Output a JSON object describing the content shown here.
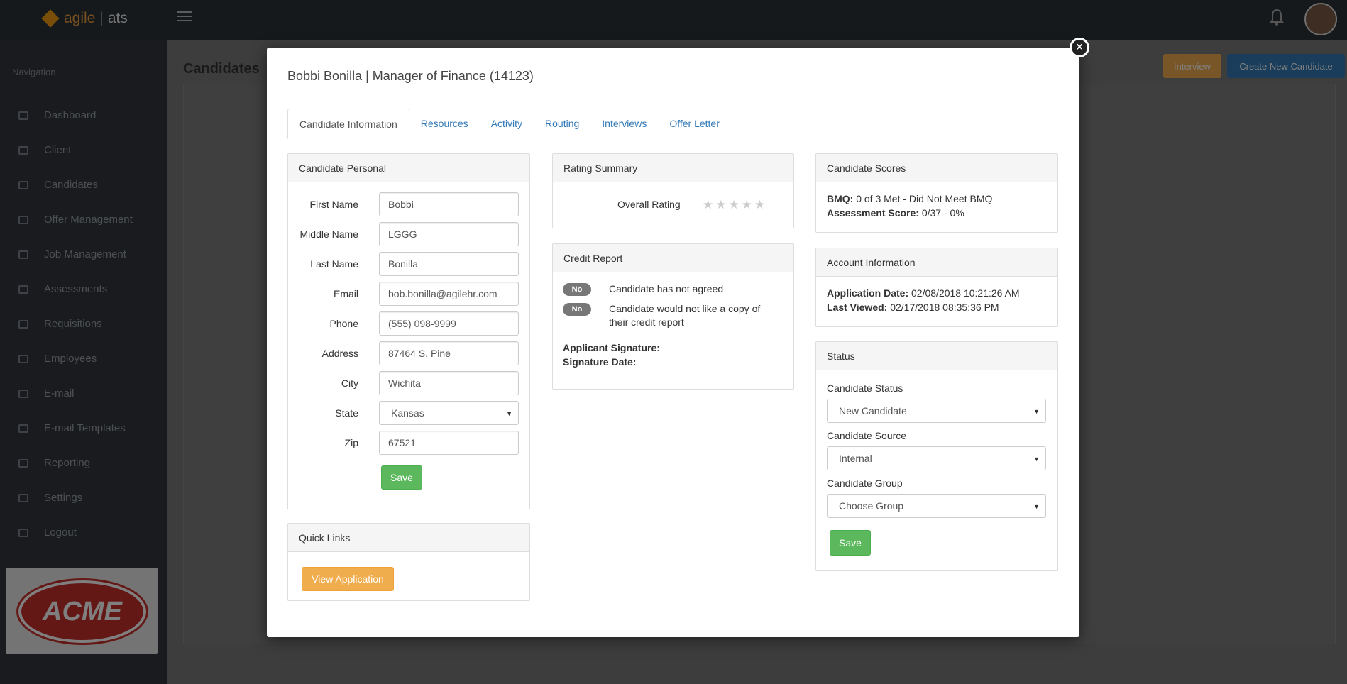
{
  "app": {
    "logo_text_1": "agile",
    "logo_sep": "|",
    "logo_text_2": "ats",
    "nav_title": "Navigation",
    "nav_items": [
      "Dashboard",
      "Client",
      "Candidates",
      "Offer Management",
      "Job Management",
      "Assessments",
      "Requisitions",
      "Employees",
      "E-mail",
      "E-mail Templates",
      "Reporting",
      "Settings",
      "Logout"
    ],
    "page_title": "Candidates",
    "interview_btn": "Interview",
    "create_btn": "Create New Candidate",
    "brand_logo": "ACME"
  },
  "modal": {
    "title": "Bobbi Bonilla | Manager of Finance (14123)",
    "close_glyph": "×",
    "tabs": [
      "Candidate Information",
      "Resources",
      "Activity",
      "Routing",
      "Interviews",
      "Offer Letter"
    ],
    "personal": {
      "heading": "Candidate Personal",
      "fields": [
        {
          "label": "First Name",
          "value": "Bobbi"
        },
        {
          "label": "Middle Name",
          "value": "LGGG"
        },
        {
          "label": "Last Name",
          "value": "Bonilla"
        },
        {
          "label": "Email",
          "value": "bob.bonilla@agilehr.com"
        },
        {
          "label": "Phone",
          "value": "(555) 098-9999"
        },
        {
          "label": "Address",
          "value": "87464 S. Pine"
        },
        {
          "label": "City",
          "value": "Wichita"
        },
        {
          "label": "State",
          "value": "Kansas"
        },
        {
          "label": "Zip",
          "value": "67521"
        }
      ],
      "save_label": "Save"
    },
    "quick_links": {
      "heading": "Quick Links",
      "view_application": "View Application"
    },
    "rating": {
      "heading": "Rating Summary",
      "label": "Overall Rating",
      "stars_filled": 0,
      "stars_total": 5
    },
    "credit": {
      "heading": "Credit Report",
      "badge_1": "No",
      "line_1": "Candidate has not agreed",
      "badge_2": "No",
      "line_2a": "Candidate would not like a copy of",
      "line_2b": "their credit report",
      "sig_label": "Applicant Signature:",
      "sig_date_label": "Signature Date:"
    },
    "scores": {
      "heading": "Candidate Scores",
      "bmq_label": "BMQ:",
      "bmq_value": "0 of 3 Met - Did Not Meet BMQ",
      "assess_label": "Assessment Score:",
      "assess_value": "0/37 - 0%"
    },
    "account": {
      "heading": "Account Information",
      "app_date_label": "Application Date:",
      "app_date_value": "02/08/2018 10:21:26 AM",
      "last_viewed_label": "Last Viewed:",
      "last_viewed_value": "02/17/2018 08:35:36 PM"
    },
    "status": {
      "heading": "Status",
      "status_label": "Candidate Status",
      "status_value": "New Candidate",
      "source_label": "Candidate Source",
      "source_value": "Internal",
      "group_label": "Candidate Group",
      "group_value": "Choose Group",
      "save_label": "Save"
    }
  }
}
